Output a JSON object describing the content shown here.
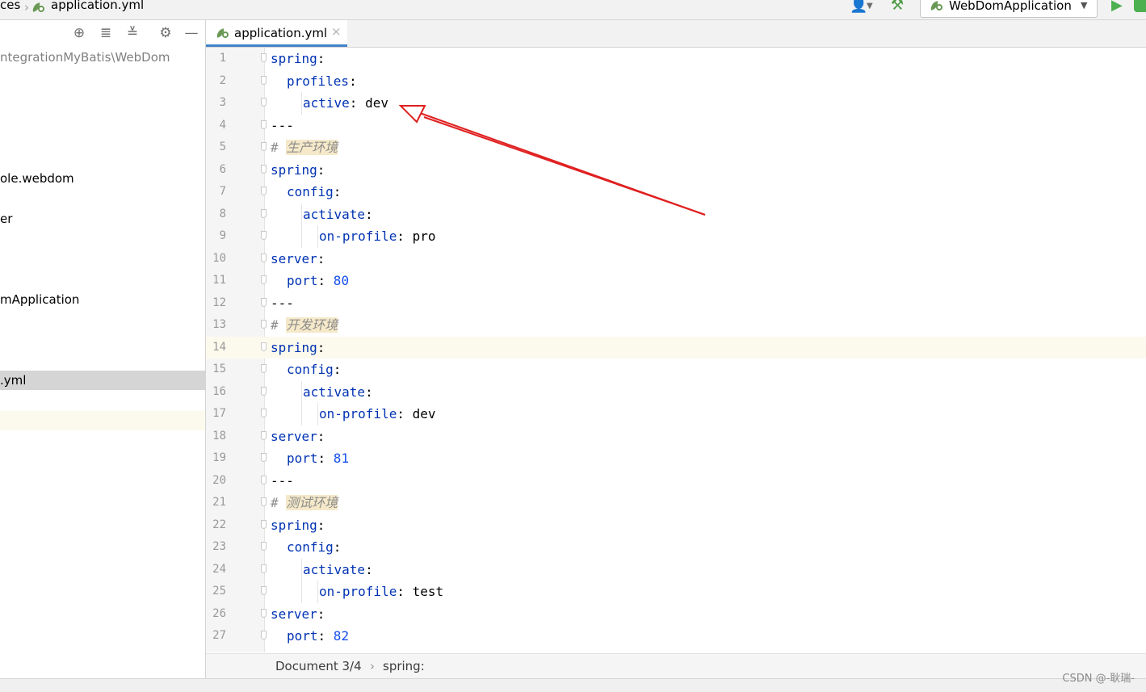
{
  "breadcrumb": {
    "parent_fragment": "ces",
    "file": "application.yml"
  },
  "toolbar": {
    "run_config": "WebDomApplication",
    "icons": [
      "user-icon",
      "build-hammer-icon",
      "run-icon",
      "debug-icon"
    ]
  },
  "sidebar": {
    "path_fragment": "ntegrationMyBatis\\WebDom",
    "items": [
      {
        "label": "ole.webdom"
      },
      {
        "label": "er"
      },
      {
        "label": "mApplication"
      },
      {
        "label": ".yml"
      }
    ],
    "toolbar_icons": [
      "locate-icon",
      "expand-all-icon",
      "collapse-all-icon",
      "settings-gear-icon",
      "hide-icon"
    ]
  },
  "editor": {
    "tab_label": "application.yml",
    "lines": [
      {
        "n": "1",
        "key": "spring",
        "sep": ":",
        "val": ""
      },
      {
        "n": "2",
        "key": "profiles",
        "sep": ":",
        "val": ""
      },
      {
        "n": "3",
        "key": "active",
        "sep": ":",
        "val": " dev"
      },
      {
        "n": "4",
        "plain": "---"
      },
      {
        "n": "5",
        "comment_hash": "#",
        "comment": "生产环境"
      },
      {
        "n": "6",
        "key": "spring",
        "sep": ":",
        "val": ""
      },
      {
        "n": "7",
        "key": "config",
        "sep": ":",
        "val": ""
      },
      {
        "n": "8",
        "key": "activate",
        "sep": ":",
        "val": ""
      },
      {
        "n": "9",
        "key": "on-profile",
        "sep": ":",
        "val": " pro"
      },
      {
        "n": "10",
        "key": "server",
        "sep": ":",
        "val": ""
      },
      {
        "n": "11",
        "key": "port",
        "sep": ":",
        "num": " 80"
      },
      {
        "n": "12",
        "plain": "---"
      },
      {
        "n": "13",
        "comment_hash": "#",
        "comment": "开发环境"
      },
      {
        "n": "14",
        "key": "spring",
        "sep": ":",
        "val": ""
      },
      {
        "n": "15",
        "key": "config",
        "sep": ":",
        "val": ""
      },
      {
        "n": "16",
        "key": "activate",
        "sep": ":",
        "val": ""
      },
      {
        "n": "17",
        "key": "on-profile",
        "sep": ":",
        "val": " dev"
      },
      {
        "n": "18",
        "key": "server",
        "sep": ":",
        "val": ""
      },
      {
        "n": "19",
        "key": "port",
        "sep": ":",
        "num": " 81"
      },
      {
        "n": "20",
        "plain": "---"
      },
      {
        "n": "21",
        "comment_hash": "#",
        "comment": "测试环境"
      },
      {
        "n": "22",
        "key": "spring",
        "sep": ":",
        "val": ""
      },
      {
        "n": "23",
        "key": "config",
        "sep": ":",
        "val": ""
      },
      {
        "n": "24",
        "key": "activate",
        "sep": ":",
        "val": ""
      },
      {
        "n": "25",
        "key": "on-profile",
        "sep": ":",
        "val": " test"
      },
      {
        "n": "26",
        "key": "server",
        "sep": ":",
        "val": ""
      },
      {
        "n": "27",
        "key": "port",
        "sep": ":",
        "num": " 82"
      }
    ]
  },
  "status": {
    "document": "Document 3/4",
    "path": "spring:"
  },
  "watermark": "CSDN @-耿瑞-",
  "colors": {
    "keyword": "#0033b3",
    "number": "#1750eb",
    "comment": "#8c8c8c",
    "comment_highlight": "#f6e9c9",
    "current_line": "#fcfaed",
    "annotation_arrow": "#e02020"
  }
}
